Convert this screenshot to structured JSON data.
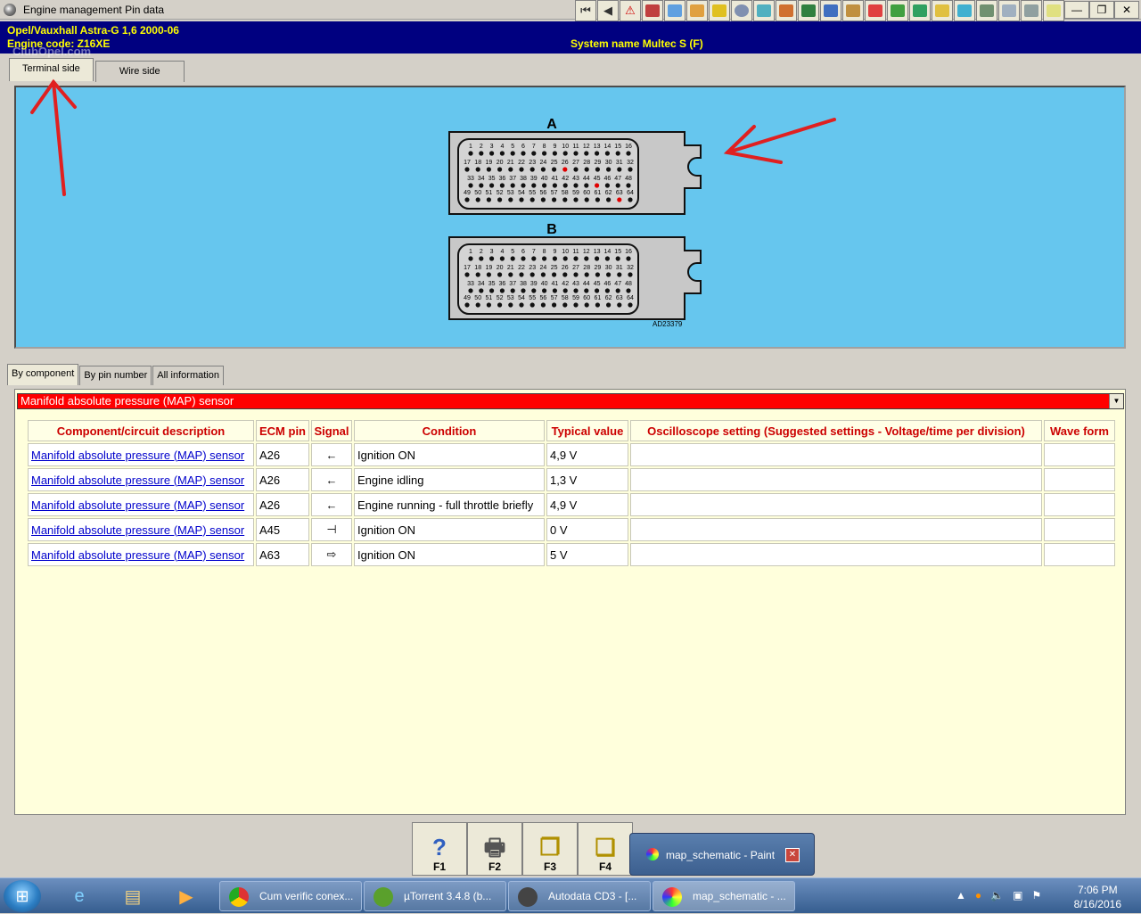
{
  "window": {
    "title": "Engine management Pin data"
  },
  "header": {
    "line1": "Opel/Vauxhall   Astra-G  1,6  2000-06",
    "line2": "Engine code: Z16XE",
    "system": "System name Multec S (F)",
    "watermark": "ClubOpel.com"
  },
  "view_tabs": [
    {
      "label": "Terminal side",
      "active": true
    },
    {
      "label": "Wire side",
      "active": false
    }
  ],
  "diagram": {
    "connector_a_label": "A",
    "connector_b_label": "B",
    "reference": "AD23379",
    "rows": [
      {
        "start": 1,
        "end": 16
      },
      {
        "start": 17,
        "end": 32
      },
      {
        "start": 33,
        "end": 48
      },
      {
        "start": 49,
        "end": 64
      }
    ],
    "highlighted_pins_a": [
      26,
      45,
      63
    ],
    "highlight_color": "#e00000"
  },
  "info_tabs": [
    {
      "label": "By component",
      "active": true
    },
    {
      "label": "By pin number",
      "active": false
    },
    {
      "label": "All information",
      "active": false
    }
  ],
  "component_select": {
    "value": "Manifold absolute pressure (MAP) sensor"
  },
  "table": {
    "headers": [
      "Component/circuit description",
      "ECM pin",
      "Signal",
      "Condition",
      "Typical value",
      "Oscilloscope setting (Suggested settings - Voltage/time per division)",
      "Wave form"
    ],
    "rows": [
      {
        "component": "Manifold absolute pressure (MAP) sensor",
        "pin": "A26",
        "signal_icon": "input-arrow-icon",
        "signal": "←",
        "condition": "Ignition ON",
        "value": "4,9 V",
        "scope": "",
        "wave": ""
      },
      {
        "component": "Manifold absolute pressure (MAP) sensor",
        "pin": "A26",
        "signal_icon": "input-arrow-icon",
        "signal": "←",
        "condition": "Engine idling",
        "value": "1,3 V",
        "scope": "",
        "wave": ""
      },
      {
        "component": "Manifold absolute pressure (MAP) sensor",
        "pin": "A26",
        "signal_icon": "input-arrow-icon",
        "signal": "←",
        "condition": "Engine running - full throttle briefly",
        "value": "4,9 V",
        "scope": "",
        "wave": ""
      },
      {
        "component": "Manifold absolute pressure (MAP) sensor",
        "pin": "A45",
        "signal_icon": "ground-icon",
        "signal": "⊣",
        "condition": "Ignition ON",
        "value": "0 V",
        "scope": "",
        "wave": ""
      },
      {
        "component": "Manifold absolute pressure (MAP) sensor",
        "pin": "A63",
        "signal_icon": "output-arrow-icon",
        "signal": "⇨",
        "condition": "Ignition ON",
        "value": "5 V",
        "scope": "",
        "wave": ""
      }
    ]
  },
  "fkeys": [
    {
      "label": "F1",
      "icon": "help-icon"
    },
    {
      "label": "F2",
      "icon": "printer-icon"
    },
    {
      "label": "F3",
      "icon": "copy-icon"
    },
    {
      "label": "F4",
      "icon": "export-icon"
    }
  ],
  "paint_popup": {
    "title": "map_schematic - Paint"
  },
  "taskbar": {
    "tasks": [
      {
        "label": "Cum verific conex..."
      },
      {
        "label": "µTorrent 3.4.8  (b..."
      },
      {
        "label": "Autodata CD3 - [..."
      },
      {
        "label": "map_schematic - ..."
      }
    ],
    "time": "7:06 PM",
    "date": "8/16/2016"
  }
}
